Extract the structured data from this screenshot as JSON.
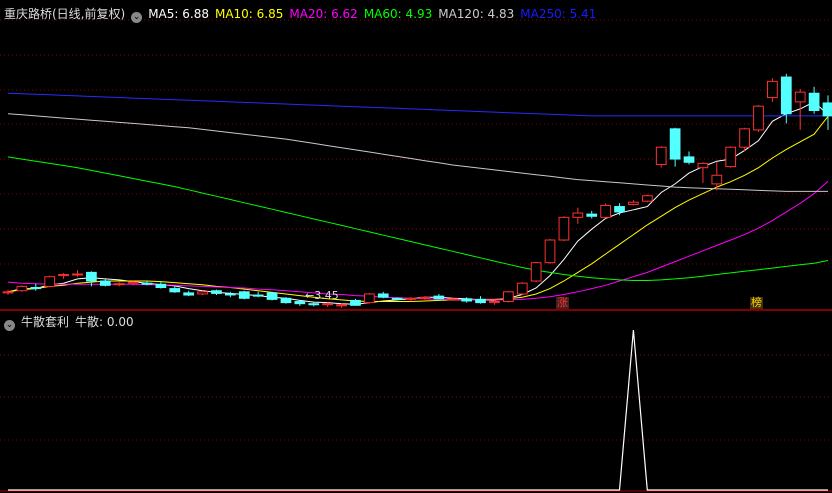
{
  "top_panel": {
    "title": "重庆路桥(日线,前复权)",
    "ma_labels": [
      {
        "text": "MA5: 6.88",
        "color": "#ffffff"
      },
      {
        "text": "MA10: 6.85",
        "color": "#ffff00"
      },
      {
        "text": "MA20: 6.62",
        "color": "#ff00ff"
      },
      {
        "text": "MA60: 4.93",
        "color": "#00ff00"
      },
      {
        "text": "MA120: 4.83",
        "color": "#cccccc"
      },
      {
        "text": "MA250: 5.41",
        "color": "#1a1aff"
      }
    ],
    "low_marker": "←3.45",
    "tag_zhang": "涨",
    "tag_bang": "榜"
  },
  "bottom_panel": {
    "title": "牛散套利",
    "value_label": "牛散: 0.00"
  },
  "colors": {
    "background": "#000000",
    "grid": "#8b0000",
    "up_candle": "#ff3030",
    "down_candle": "#54ffff",
    "indicator_line": "#ffffff"
  },
  "chart_data": {
    "type": "candlestick",
    "candles": [
      {
        "o": 3.58,
        "h": 3.64,
        "l": 3.54,
        "c": 3.6
      },
      {
        "o": 3.62,
        "h": 3.72,
        "l": 3.6,
        "c": 3.7
      },
      {
        "o": 3.68,
        "h": 3.75,
        "l": 3.62,
        "c": 3.66
      },
      {
        "o": 3.7,
        "h": 3.9,
        "l": 3.68,
        "c": 3.88
      },
      {
        "o": 3.9,
        "h": 3.95,
        "l": 3.84,
        "c": 3.92
      },
      {
        "o": 3.92,
        "h": 4.0,
        "l": 3.88,
        "c": 3.93
      },
      {
        "o": 3.96,
        "h": 3.98,
        "l": 3.7,
        "c": 3.8
      },
      {
        "o": 3.8,
        "h": 3.84,
        "l": 3.7,
        "c": 3.72
      },
      {
        "o": 3.74,
        "h": 3.78,
        "l": 3.7,
        "c": 3.75
      },
      {
        "o": 3.76,
        "h": 3.8,
        "l": 3.72,
        "c": 3.78
      },
      {
        "o": 3.76,
        "h": 3.8,
        "l": 3.72,
        "c": 3.74
      },
      {
        "o": 3.74,
        "h": 3.78,
        "l": 3.66,
        "c": 3.68
      },
      {
        "o": 3.66,
        "h": 3.7,
        "l": 3.58,
        "c": 3.6
      },
      {
        "o": 3.58,
        "h": 3.62,
        "l": 3.52,
        "c": 3.54
      },
      {
        "o": 3.56,
        "h": 3.62,
        "l": 3.54,
        "c": 3.6
      },
      {
        "o": 3.62,
        "h": 3.64,
        "l": 3.54,
        "c": 3.57
      },
      {
        "o": 3.56,
        "h": 3.6,
        "l": 3.5,
        "c": 3.55
      },
      {
        "o": 3.6,
        "h": 3.62,
        "l": 3.46,
        "c": 3.48
      },
      {
        "o": 3.54,
        "h": 3.6,
        "l": 3.5,
        "c": 3.52
      },
      {
        "o": 3.58,
        "h": 3.6,
        "l": 3.44,
        "c": 3.46
      },
      {
        "o": 3.48,
        "h": 3.5,
        "l": 3.38,
        "c": 3.4
      },
      {
        "o": 3.42,
        "h": 3.45,
        "l": 3.34,
        "c": 3.38
      },
      {
        "o": 3.38,
        "h": 3.4,
        "l": 3.33,
        "c": 3.36
      },
      {
        "o": 3.36,
        "h": 3.4,
        "l": 3.32,
        "c": 3.38
      },
      {
        "o": 3.34,
        "h": 3.38,
        "l": 3.3,
        "c": 3.36
      },
      {
        "o": 3.44,
        "h": 3.47,
        "l": 3.34,
        "c": 3.35
      },
      {
        "o": 3.4,
        "h": 3.58,
        "l": 3.38,
        "c": 3.56
      },
      {
        "o": 3.56,
        "h": 3.6,
        "l": 3.48,
        "c": 3.5
      },
      {
        "o": 3.48,
        "h": 3.5,
        "l": 3.44,
        "c": 3.46
      },
      {
        "o": 3.46,
        "h": 3.5,
        "l": 3.42,
        "c": 3.48
      },
      {
        "o": 3.48,
        "h": 3.52,
        "l": 3.45,
        "c": 3.5
      },
      {
        "o": 3.52,
        "h": 3.56,
        "l": 3.46,
        "c": 3.47
      },
      {
        "o": 3.46,
        "h": 3.5,
        "l": 3.43,
        "c": 3.47
      },
      {
        "o": 3.47,
        "h": 3.5,
        "l": 3.4,
        "c": 3.43
      },
      {
        "o": 3.46,
        "h": 3.52,
        "l": 3.38,
        "c": 3.4
      },
      {
        "o": 3.4,
        "h": 3.46,
        "l": 3.36,
        "c": 3.42
      },
      {
        "o": 3.42,
        "h": 3.62,
        "l": 3.4,
        "c": 3.6
      },
      {
        "o": 3.56,
        "h": 3.78,
        "l": 3.54,
        "c": 3.76
      },
      {
        "o": 3.8,
        "h": 4.15,
        "l": 3.78,
        "c": 4.14
      },
      {
        "o": 4.14,
        "h": 4.58,
        "l": 4.12,
        "c": 4.56
      },
      {
        "o": 4.56,
        "h": 5.0,
        "l": 4.54,
        "c": 4.98
      },
      {
        "o": 4.98,
        "h": 5.16,
        "l": 4.86,
        "c": 5.06
      },
      {
        "o": 5.04,
        "h": 5.1,
        "l": 4.96,
        "c": 5.0
      },
      {
        "o": 4.98,
        "h": 5.24,
        "l": 4.96,
        "c": 5.2
      },
      {
        "o": 5.18,
        "h": 5.24,
        "l": 5.02,
        "c": 5.08
      },
      {
        "o": 5.22,
        "h": 5.3,
        "l": 5.2,
        "c": 5.26
      },
      {
        "o": 5.28,
        "h": 5.4,
        "l": 5.26,
        "c": 5.38
      },
      {
        "o": 5.96,
        "h": 6.3,
        "l": 5.9,
        "c": 6.28
      },
      {
        "o": 6.62,
        "h": 6.64,
        "l": 5.92,
        "c": 6.06
      },
      {
        "o": 6.1,
        "h": 6.2,
        "l": 5.96,
        "c": 6.0
      },
      {
        "o": 5.9,
        "h": 6.0,
        "l": 5.62,
        "c": 5.98
      },
      {
        "o": 5.6,
        "h": 6.0,
        "l": 5.48,
        "c": 5.76
      },
      {
        "o": 5.92,
        "h": 6.3,
        "l": 5.9,
        "c": 6.28
      },
      {
        "o": 6.28,
        "h": 6.64,
        "l": 6.2,
        "c": 6.62
      },
      {
        "o": 6.6,
        "h": 7.06,
        "l": 6.56,
        "c": 7.04
      },
      {
        "o": 7.2,
        "h": 7.56,
        "l": 7.12,
        "c": 7.5
      },
      {
        "o": 7.58,
        "h": 7.64,
        "l": 6.72,
        "c": 6.9
      },
      {
        "o": 7.12,
        "h": 7.36,
        "l": 6.6,
        "c": 7.3
      },
      {
        "o": 7.28,
        "h": 7.4,
        "l": 6.9,
        "c": 6.96
      },
      {
        "o": 7.1,
        "h": 7.24,
        "l": 6.6,
        "c": 6.86
      }
    ],
    "moving_averages": [
      {
        "name": "MA5",
        "color": "#ffffff",
        "values": [
          3.6,
          3.66,
          3.66,
          3.73,
          3.76,
          3.84,
          3.86,
          3.84,
          3.82,
          3.79,
          3.76,
          3.73,
          3.71,
          3.66,
          3.62,
          3.59,
          3.57,
          3.55,
          3.53,
          3.5,
          3.48,
          3.44,
          3.41,
          3.4,
          3.38,
          3.37,
          3.4,
          3.43,
          3.45,
          3.47,
          3.5,
          3.5,
          3.48,
          3.47,
          3.45,
          3.44,
          3.48,
          3.55,
          3.67,
          3.9,
          4.2,
          4.54,
          4.76,
          4.96,
          5.06,
          5.12,
          5.18,
          5.44,
          5.6,
          5.8,
          5.92,
          6.02,
          6.06,
          6.22,
          6.4,
          6.76,
          6.9,
          6.99,
          7.12,
          6.88
        ]
      },
      {
        "name": "MA10",
        "color": "#ffff00",
        "values": [
          3.6,
          3.64,
          3.66,
          3.7,
          3.72,
          3.76,
          3.78,
          3.8,
          3.8,
          3.8,
          3.8,
          3.79,
          3.77,
          3.75,
          3.73,
          3.7,
          3.68,
          3.65,
          3.62,
          3.59,
          3.56,
          3.53,
          3.5,
          3.47,
          3.45,
          3.43,
          3.42,
          3.42,
          3.42,
          3.42,
          3.43,
          3.44,
          3.45,
          3.45,
          3.46,
          3.46,
          3.47,
          3.5,
          3.56,
          3.66,
          3.8,
          3.96,
          4.12,
          4.3,
          4.48,
          4.66,
          4.84,
          5.0,
          5.16,
          5.3,
          5.42,
          5.54,
          5.64,
          5.76,
          5.9,
          6.08,
          6.24,
          6.38,
          6.52,
          6.85
        ]
      },
      {
        "name": "MA20",
        "color": "#ff00ff",
        "values": [
          3.78,
          3.76,
          3.75,
          3.74,
          3.74,
          3.74,
          3.74,
          3.74,
          3.74,
          3.74,
          3.73,
          3.73,
          3.72,
          3.71,
          3.7,
          3.69,
          3.68,
          3.67,
          3.65,
          3.64,
          3.62,
          3.6,
          3.58,
          3.56,
          3.55,
          3.53,
          3.52,
          3.5,
          3.49,
          3.48,
          3.47,
          3.46,
          3.46,
          3.45,
          3.45,
          3.45,
          3.45,
          3.46,
          3.48,
          3.51,
          3.55,
          3.6,
          3.66,
          3.72,
          3.8,
          3.88,
          3.96,
          4.06,
          4.16,
          4.26,
          4.36,
          4.46,
          4.56,
          4.66,
          4.78,
          4.92,
          5.08,
          5.24,
          5.42,
          5.65
        ]
      },
      {
        "name": "MA60",
        "color": "#00ff00",
        "values": [
          6.1,
          6.06,
          6.02,
          5.98,
          5.94,
          5.9,
          5.85,
          5.8,
          5.75,
          5.7,
          5.65,
          5.6,
          5.55,
          5.49,
          5.43,
          5.37,
          5.31,
          5.25,
          5.19,
          5.13,
          5.07,
          5.01,
          4.95,
          4.89,
          4.83,
          4.77,
          4.71,
          4.65,
          4.59,
          4.53,
          4.47,
          4.41,
          4.35,
          4.29,
          4.23,
          4.17,
          4.11,
          4.05,
          4.0,
          3.96,
          3.92,
          3.89,
          3.86,
          3.84,
          3.82,
          3.81,
          3.81,
          3.82,
          3.84,
          3.86,
          3.89,
          3.92,
          3.95,
          3.98,
          4.01,
          4.04,
          4.07,
          4.1,
          4.13,
          4.18
        ]
      },
      {
        "name": "MA120",
        "color": "#c8c8c8",
        "values": [
          6.9,
          6.88,
          6.86,
          6.84,
          6.82,
          6.8,
          6.78,
          6.76,
          6.74,
          6.72,
          6.7,
          6.68,
          6.66,
          6.64,
          6.61,
          6.58,
          6.55,
          6.52,
          6.49,
          6.46,
          6.43,
          6.39,
          6.35,
          6.31,
          6.27,
          6.23,
          6.19,
          6.15,
          6.11,
          6.07,
          6.03,
          5.99,
          5.95,
          5.92,
          5.89,
          5.86,
          5.83,
          5.8,
          5.77,
          5.74,
          5.71,
          5.68,
          5.66,
          5.64,
          5.62,
          5.6,
          5.58,
          5.56,
          5.54,
          5.53,
          5.52,
          5.51,
          5.5,
          5.49,
          5.48,
          5.47,
          5.46,
          5.46,
          5.46,
          5.46
        ]
      },
      {
        "name": "MA250",
        "color": "#2a2aff",
        "values": [
          7.28,
          7.27,
          7.26,
          7.25,
          7.24,
          7.23,
          7.22,
          7.21,
          7.2,
          7.19,
          7.18,
          7.17,
          7.16,
          7.15,
          7.14,
          7.13,
          7.12,
          7.11,
          7.1,
          7.09,
          7.08,
          7.07,
          7.06,
          7.05,
          7.04,
          7.03,
          7.02,
          7.01,
          7.0,
          6.99,
          6.98,
          6.97,
          6.96,
          6.95,
          6.94,
          6.93,
          6.92,
          6.91,
          6.9,
          6.89,
          6.88,
          6.87,
          6.86,
          6.86,
          6.86,
          6.86,
          6.86,
          6.86,
          6.86,
          6.86,
          6.86,
          6.86,
          6.86,
          6.86,
          6.86,
          6.86,
          6.86,
          6.86,
          6.86,
          6.86
        ]
      }
    ],
    "price_range": [
      3.3,
      8.6
    ],
    "indicator": {
      "name": "牛散",
      "values": [
        0,
        0,
        0,
        0,
        0,
        0,
        0,
        0,
        0,
        0,
        0,
        0,
        0,
        0,
        0,
        0,
        0,
        0,
        0,
        0,
        0,
        0,
        0,
        0,
        0,
        0,
        0,
        0,
        0,
        0,
        0,
        0,
        0,
        0,
        0,
        0,
        0,
        0,
        0,
        0,
        0,
        0,
        0,
        0,
        0,
        1,
        0,
        0,
        0,
        0,
        0,
        0,
        0,
        0,
        0,
        0,
        0,
        0,
        0,
        0
      ],
      "range": [
        0,
        1
      ]
    },
    "grid": true
  }
}
